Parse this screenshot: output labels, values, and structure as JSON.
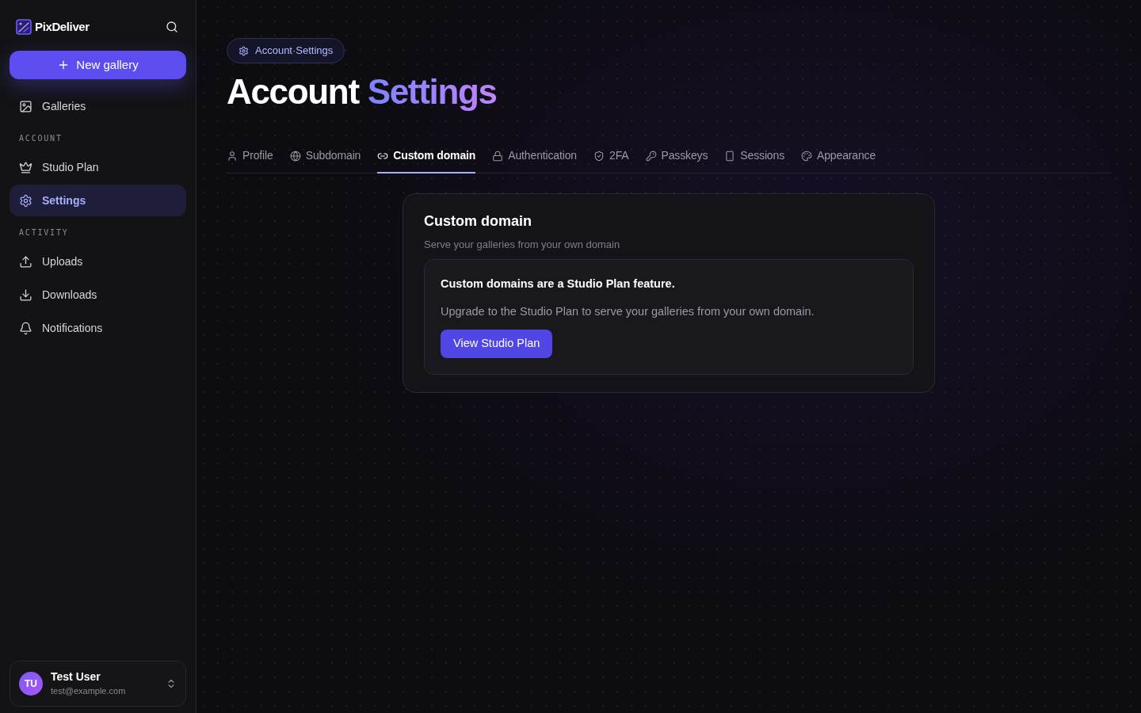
{
  "sidebar": {
    "brand": "PixDeliver",
    "new_button": "New gallery",
    "items": [
      {
        "label": "Galleries",
        "selected": false
      }
    ],
    "sections": [
      {
        "heading": "ACCOUNT",
        "items": [
          {
            "label": "Studio Plan",
            "selected": false
          },
          {
            "label": "Settings",
            "selected": true
          }
        ]
      },
      {
        "heading": "ACTIVITY",
        "items": [
          {
            "label": "Uploads",
            "selected": false
          },
          {
            "label": "Downloads",
            "selected": false
          },
          {
            "label": "Notifications",
            "selected": false
          }
        ]
      }
    ],
    "user": {
      "initials": "TU",
      "name": "Test User",
      "email": "test@example.com"
    }
  },
  "breadcrumb": "Account·Settings",
  "title": {
    "plain": "Account",
    "accent": "Settings"
  },
  "tabs": [
    {
      "label": "Profile",
      "selected": false
    },
    {
      "label": "Subdomain",
      "selected": false
    },
    {
      "label": "Custom domain",
      "selected": true
    },
    {
      "label": "Authentication",
      "selected": false
    },
    {
      "label": "2FA",
      "selected": false
    },
    {
      "label": "Passkeys",
      "selected": false
    },
    {
      "label": "Sessions",
      "selected": false
    },
    {
      "label": "Appearance",
      "selected": false
    }
  ],
  "card": {
    "title": "Custom domain",
    "subtitle": "Serve your galleries from your own domain",
    "notice": {
      "heading": "Custom domains are a Studio Plan feature.",
      "body": "Upgrade to the Studio Plan to serve your galleries from your own domain.",
      "button": "View Studio Plan"
    }
  }
}
